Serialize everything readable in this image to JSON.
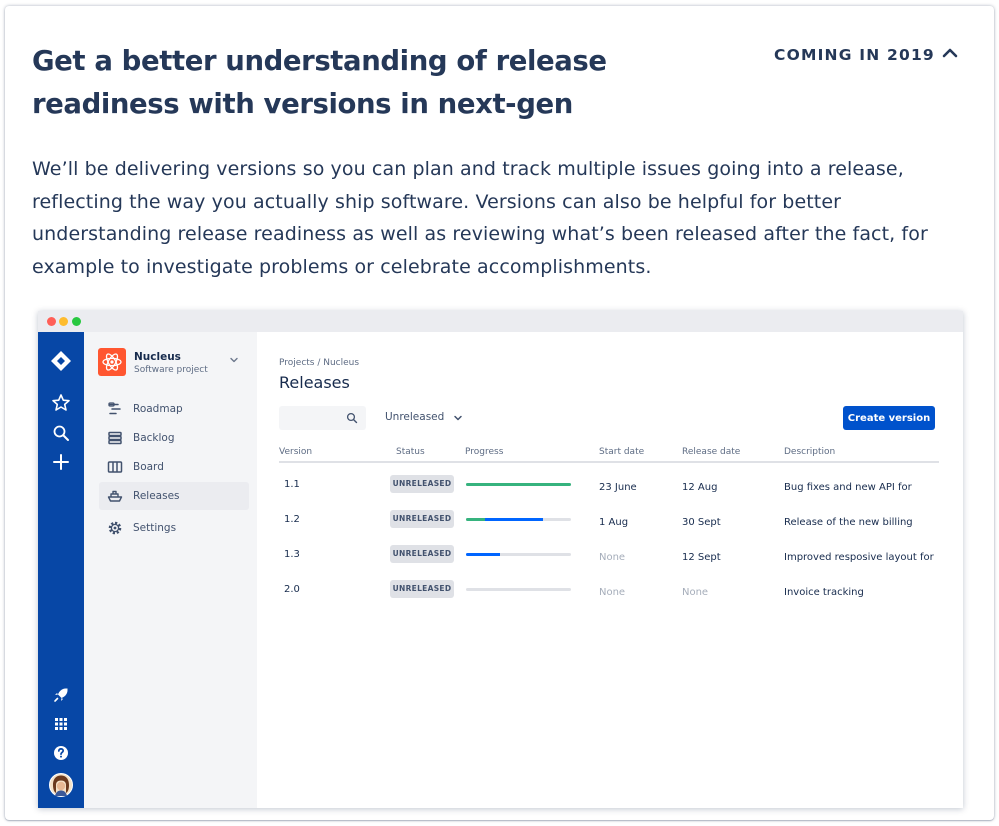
{
  "card": {
    "title": "Get a better understanding of release readiness with versions in next-gen",
    "badge": "COMING IN 2019",
    "description": "We’ll be delivering versions so you can plan and track multiple issues going into a release, reflecting the way you actually ship software. Versions can also be helpful for better understanding release readiness as well as reviewing what’s been released after the fact, for example to investigate problems or celebrate accomplishments."
  },
  "app": {
    "project": {
      "name": "Nucleus",
      "type": "Software project"
    },
    "sidebar": {
      "items": [
        {
          "label": "Roadmap",
          "icon": "roadmap-icon"
        },
        {
          "label": "Backlog",
          "icon": "backlog-icon"
        },
        {
          "label": "Board",
          "icon": "board-icon"
        },
        {
          "label": "Releases",
          "icon": "ship-icon",
          "active": true
        },
        {
          "label": "Settings",
          "icon": "gear-icon"
        }
      ]
    },
    "breadcrumb": "Projects / Nucleus",
    "page_title": "Releases",
    "filter": {
      "selected": "Unreleased"
    },
    "create_button": "Create version",
    "columns": {
      "version": "Version",
      "status": "Status",
      "progress": "Progress",
      "start_date": "Start date",
      "release_date": "Release date",
      "description": "Description"
    },
    "rows": [
      {
        "version": "1.1",
        "status": "UNRELEASED",
        "done": 1.0,
        "in_progress": 0.0,
        "start_date": "23 June",
        "release_date": "12 Aug",
        "description": "Bug fixes and new API for"
      },
      {
        "version": "1.2",
        "status": "UNRELEASED",
        "done": 0.18,
        "in_progress": 0.55,
        "start_date": "1 Aug",
        "release_date": "30 Sept",
        "description": "Release of the new billing"
      },
      {
        "version": "1.3",
        "status": "UNRELEASED",
        "done": 0.0,
        "in_progress": 0.32,
        "start_date": "None",
        "release_date": "12 Sept",
        "description": "Improved resposive layout for"
      },
      {
        "version": "2.0",
        "status": "UNRELEASED",
        "done": 0.0,
        "in_progress": 0.0,
        "start_date": "None",
        "release_date": "None",
        "description": "Invoice tracking"
      }
    ]
  },
  "colors": {
    "global_nav": "#0747A6",
    "primary_button": "#0052CC",
    "progress_done": "#36B37E",
    "progress_in_progress": "#0065FF",
    "project_avatar": "#FF5630"
  }
}
